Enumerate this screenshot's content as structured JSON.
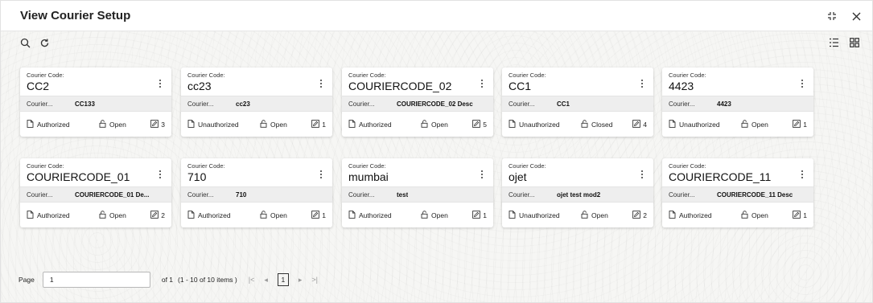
{
  "header": {
    "title": "View Courier Setup"
  },
  "icons": {
    "search": "search-icon",
    "refresh": "refresh-icon",
    "expand": "expand-icon",
    "close": "close-icon",
    "list_view": "list-view-icon",
    "tile_view": "tile-view-icon"
  },
  "card_labels": {
    "code_label": "Courier Code:",
    "desc_label": "Courier..."
  },
  "cards": [
    {
      "code": "CC2",
      "desc": "CC133",
      "auth": "Authorized",
      "status": "Open",
      "mods": "3"
    },
    {
      "code": "cc23",
      "desc": "cc23",
      "auth": "Unauthorized",
      "status": "Open",
      "mods": "1"
    },
    {
      "code": "COURIERCODE_02",
      "desc": "COURIERCODE_02 Desc",
      "auth": "Authorized",
      "status": "Open",
      "mods": "5"
    },
    {
      "code": "CC1",
      "desc": "CC1",
      "auth": "Unauthorized",
      "status": "Closed",
      "mods": "4"
    },
    {
      "code": "4423",
      "desc": "4423",
      "auth": "Unauthorized",
      "status": "Open",
      "mods": "1"
    },
    {
      "code": "COURIERCODE_01",
      "desc": "COURIERCODE_01 De...",
      "auth": "Authorized",
      "status": "Open",
      "mods": "2"
    },
    {
      "code": "710",
      "desc": "710",
      "auth": "Authorized",
      "status": "Open",
      "mods": "1"
    },
    {
      "code": "mumbai",
      "desc": "test",
      "auth": "Authorized",
      "status": "Open",
      "mods": "1"
    },
    {
      "code": "ojet",
      "desc": "ojet test mod2",
      "auth": "Unauthorized",
      "status": "Open",
      "mods": "2"
    },
    {
      "code": "COURIERCODE_11",
      "desc": "COURIERCODE_11 Desc",
      "auth": "Authorized",
      "status": "Open",
      "mods": "1"
    }
  ],
  "pagination": {
    "page_label": "Page",
    "page_value": "1",
    "of_label": "of 1",
    "range_text": "(1 - 10 of 10 items )",
    "current_page": "1"
  }
}
